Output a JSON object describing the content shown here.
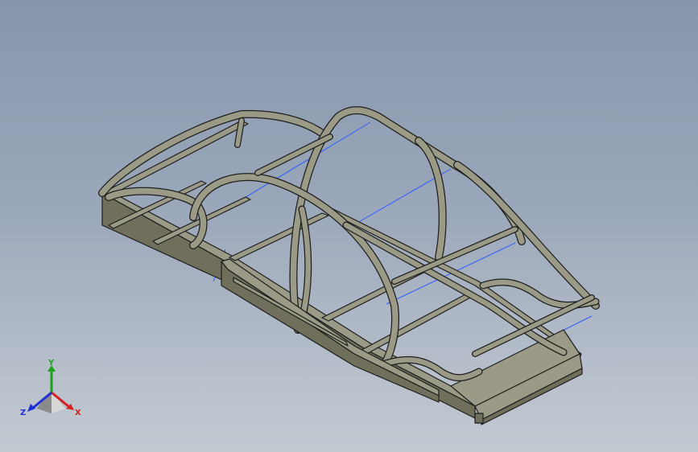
{
  "viewport": {
    "background_top": "#8796ad",
    "background_bottom": "#c4cad2",
    "model_fill": "#9a9a86",
    "model_side": "#6f6f5c",
    "model_edge": "#1e1e1e",
    "sketch_line_color": "#2f5cff"
  },
  "triad": {
    "x_label": "X",
    "y_label": "Y",
    "z_label": "Z",
    "x_color": "#d42020",
    "y_color": "#1fa01f",
    "z_color": "#2030d0"
  }
}
